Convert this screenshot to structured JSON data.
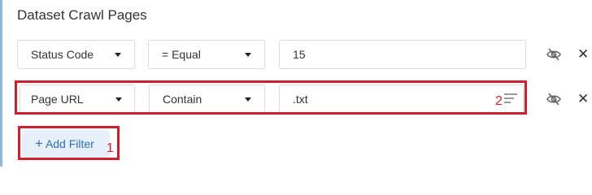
{
  "section": {
    "title": "Dataset Crawl Pages"
  },
  "filters": [
    {
      "field": "Status Code",
      "operator": "= Equal",
      "value": "15"
    },
    {
      "field": "Page URL",
      "operator": "Contain",
      "value": ".txt"
    }
  ],
  "add_filter": {
    "label": "Add Filter"
  },
  "annotations": {
    "marker_1": "1",
    "marker_2": "2",
    "color": "#d0202e"
  },
  "icons": {
    "visibility": "eye-off-icon",
    "remove": "close-icon",
    "menu": "menu-lines-icon",
    "add": "plus-icon"
  }
}
